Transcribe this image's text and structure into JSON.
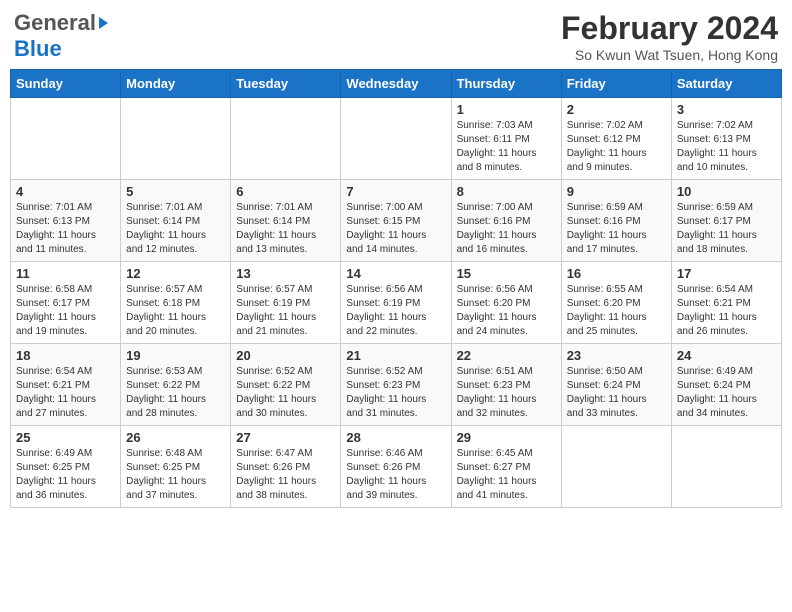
{
  "header": {
    "logo_general": "General",
    "logo_blue": "Blue",
    "title": "February 2024",
    "subtitle": "So Kwun Wat Tsuen, Hong Kong"
  },
  "weekdays": [
    "Sunday",
    "Monday",
    "Tuesday",
    "Wednesday",
    "Thursday",
    "Friday",
    "Saturday"
  ],
  "weeks": [
    [
      {
        "date": "",
        "info": ""
      },
      {
        "date": "",
        "info": ""
      },
      {
        "date": "",
        "info": ""
      },
      {
        "date": "",
        "info": ""
      },
      {
        "date": "1",
        "info": "Sunrise: 7:03 AM\nSunset: 6:11 PM\nDaylight: 11 hours\nand 8 minutes."
      },
      {
        "date": "2",
        "info": "Sunrise: 7:02 AM\nSunset: 6:12 PM\nDaylight: 11 hours\nand 9 minutes."
      },
      {
        "date": "3",
        "info": "Sunrise: 7:02 AM\nSunset: 6:13 PM\nDaylight: 11 hours\nand 10 minutes."
      }
    ],
    [
      {
        "date": "4",
        "info": "Sunrise: 7:01 AM\nSunset: 6:13 PM\nDaylight: 11 hours\nand 11 minutes."
      },
      {
        "date": "5",
        "info": "Sunrise: 7:01 AM\nSunset: 6:14 PM\nDaylight: 11 hours\nand 12 minutes."
      },
      {
        "date": "6",
        "info": "Sunrise: 7:01 AM\nSunset: 6:14 PM\nDaylight: 11 hours\nand 13 minutes."
      },
      {
        "date": "7",
        "info": "Sunrise: 7:00 AM\nSunset: 6:15 PM\nDaylight: 11 hours\nand 14 minutes."
      },
      {
        "date": "8",
        "info": "Sunrise: 7:00 AM\nSunset: 6:16 PM\nDaylight: 11 hours\nand 16 minutes."
      },
      {
        "date": "9",
        "info": "Sunrise: 6:59 AM\nSunset: 6:16 PM\nDaylight: 11 hours\nand 17 minutes."
      },
      {
        "date": "10",
        "info": "Sunrise: 6:59 AM\nSunset: 6:17 PM\nDaylight: 11 hours\nand 18 minutes."
      }
    ],
    [
      {
        "date": "11",
        "info": "Sunrise: 6:58 AM\nSunset: 6:17 PM\nDaylight: 11 hours\nand 19 minutes."
      },
      {
        "date": "12",
        "info": "Sunrise: 6:57 AM\nSunset: 6:18 PM\nDaylight: 11 hours\nand 20 minutes."
      },
      {
        "date": "13",
        "info": "Sunrise: 6:57 AM\nSunset: 6:19 PM\nDaylight: 11 hours\nand 21 minutes."
      },
      {
        "date": "14",
        "info": "Sunrise: 6:56 AM\nSunset: 6:19 PM\nDaylight: 11 hours\nand 22 minutes."
      },
      {
        "date": "15",
        "info": "Sunrise: 6:56 AM\nSunset: 6:20 PM\nDaylight: 11 hours\nand 24 minutes."
      },
      {
        "date": "16",
        "info": "Sunrise: 6:55 AM\nSunset: 6:20 PM\nDaylight: 11 hours\nand 25 minutes."
      },
      {
        "date": "17",
        "info": "Sunrise: 6:54 AM\nSunset: 6:21 PM\nDaylight: 11 hours\nand 26 minutes."
      }
    ],
    [
      {
        "date": "18",
        "info": "Sunrise: 6:54 AM\nSunset: 6:21 PM\nDaylight: 11 hours\nand 27 minutes."
      },
      {
        "date": "19",
        "info": "Sunrise: 6:53 AM\nSunset: 6:22 PM\nDaylight: 11 hours\nand 28 minutes."
      },
      {
        "date": "20",
        "info": "Sunrise: 6:52 AM\nSunset: 6:22 PM\nDaylight: 11 hours\nand 30 minutes."
      },
      {
        "date": "21",
        "info": "Sunrise: 6:52 AM\nSunset: 6:23 PM\nDaylight: 11 hours\nand 31 minutes."
      },
      {
        "date": "22",
        "info": "Sunrise: 6:51 AM\nSunset: 6:23 PM\nDaylight: 11 hours\nand 32 minutes."
      },
      {
        "date": "23",
        "info": "Sunrise: 6:50 AM\nSunset: 6:24 PM\nDaylight: 11 hours\nand 33 minutes."
      },
      {
        "date": "24",
        "info": "Sunrise: 6:49 AM\nSunset: 6:24 PM\nDaylight: 11 hours\nand 34 minutes."
      }
    ],
    [
      {
        "date": "25",
        "info": "Sunrise: 6:49 AM\nSunset: 6:25 PM\nDaylight: 11 hours\nand 36 minutes."
      },
      {
        "date": "26",
        "info": "Sunrise: 6:48 AM\nSunset: 6:25 PM\nDaylight: 11 hours\nand 37 minutes."
      },
      {
        "date": "27",
        "info": "Sunrise: 6:47 AM\nSunset: 6:26 PM\nDaylight: 11 hours\nand 38 minutes."
      },
      {
        "date": "28",
        "info": "Sunrise: 6:46 AM\nSunset: 6:26 PM\nDaylight: 11 hours\nand 39 minutes."
      },
      {
        "date": "29",
        "info": "Sunrise: 6:45 AM\nSunset: 6:27 PM\nDaylight: 11 hours\nand 41 minutes."
      },
      {
        "date": "",
        "info": ""
      },
      {
        "date": "",
        "info": ""
      }
    ]
  ]
}
